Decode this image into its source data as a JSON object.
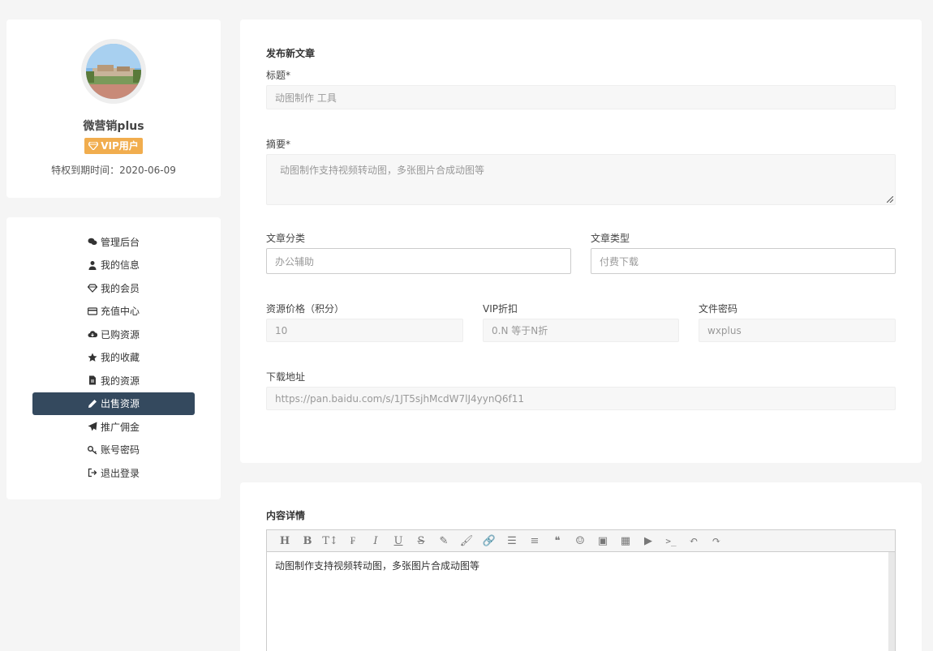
{
  "profile": {
    "username": "微营销plus",
    "vip_label": "VIP用户",
    "expire_text": "特权到期时间：2020-06-09"
  },
  "nav": {
    "items": [
      {
        "label": "管理后台",
        "icon": "wechat-icon"
      },
      {
        "label": "我的信息",
        "icon": "user-icon"
      },
      {
        "label": "我的会员",
        "icon": "diamond-icon"
      },
      {
        "label": "充值中心",
        "icon": "credit-card-icon"
      },
      {
        "label": "已购资源",
        "icon": "cloud-download-icon"
      },
      {
        "label": "我的收藏",
        "icon": "star-icon"
      },
      {
        "label": "我的资源",
        "icon": "file-icon"
      },
      {
        "label": "出售资源",
        "icon": "pencil-icon",
        "active": true
      },
      {
        "label": "推广佣金",
        "icon": "paper-plane-icon"
      },
      {
        "label": "账号密码",
        "icon": "key-icon"
      },
      {
        "label": "退出登录",
        "icon": "sign-out-icon"
      }
    ]
  },
  "form": {
    "section_title": "发布新文章",
    "title_label": "标题*",
    "title_placeholder": "动图制作 工具",
    "summary_label": "摘要*",
    "summary_placeholder": "动图制作支持视频转动图，多张图片合成动图等",
    "category_label": "文章分类",
    "category_placeholder": "办公辅助",
    "type_label": "文章类型",
    "type_placeholder": "付费下载",
    "price_label": "资源价格（积分）",
    "price_placeholder": "10",
    "vip_discount_label": "VIP折扣",
    "vip_discount_placeholder": "0.N 等于N折",
    "password_label": "文件密码",
    "password_placeholder": "wxplus",
    "download_label": "下载地址",
    "download_placeholder": "https://pan.baidu.com/s/1JT5sjhMcdW7lJ4yynQ6f11"
  },
  "editor": {
    "section_title": "内容详情",
    "content": "动图制作支持视频转动图，多张图片合成动图等",
    "toolbar": [
      {
        "name": "heading-icon",
        "glyph": "H"
      },
      {
        "name": "bold-icon",
        "glyph": "B"
      },
      {
        "name": "font-size-icon",
        "glyph": "T↕"
      },
      {
        "name": "font-family-icon",
        "glyph": "₣"
      },
      {
        "name": "italic-icon",
        "glyph": "I"
      },
      {
        "name": "underline-icon",
        "glyph": "U"
      },
      {
        "name": "strikethrough-icon",
        "glyph": "S"
      },
      {
        "name": "highlight-icon",
        "glyph": "✎"
      },
      {
        "name": "brush-icon",
        "glyph": "🖌"
      },
      {
        "name": "link-icon",
        "glyph": "🔗"
      },
      {
        "name": "list-icon",
        "glyph": "☰"
      },
      {
        "name": "align-icon",
        "glyph": "≡"
      },
      {
        "name": "quote-icon",
        "glyph": "❝"
      },
      {
        "name": "emoji-icon",
        "glyph": "☺"
      },
      {
        "name": "image-icon",
        "glyph": "▣"
      },
      {
        "name": "table-icon",
        "glyph": "▦"
      },
      {
        "name": "video-icon",
        "glyph": "▶"
      },
      {
        "name": "code-icon",
        "glyph": ">_"
      },
      {
        "name": "undo-icon",
        "glyph": "↶"
      },
      {
        "name": "redo-icon",
        "glyph": "↷"
      }
    ]
  },
  "colors": {
    "nav_active_bg": "#34495e",
    "vip_badge_bg": "#f1ad4e",
    "page_bg": "#f5f5f5"
  }
}
